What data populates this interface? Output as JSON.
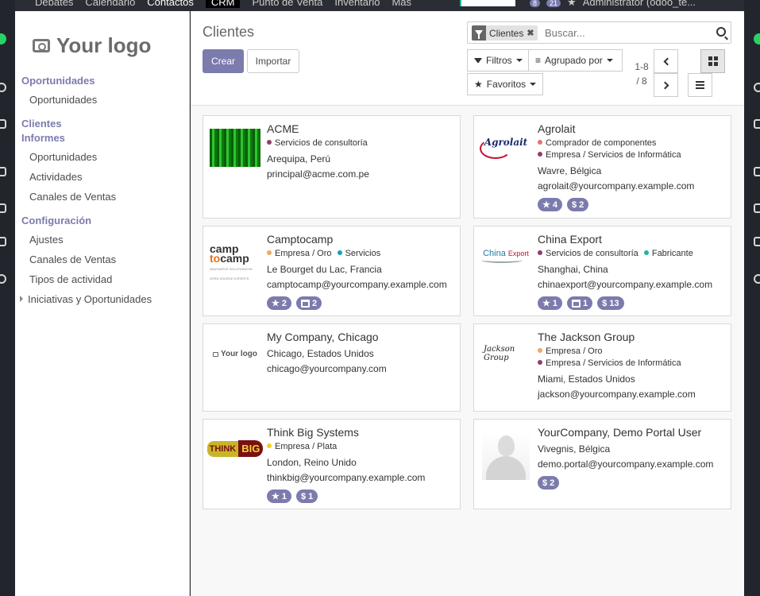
{
  "topnav": {
    "menu": [
      "Debates",
      "Calendario",
      "Contactos",
      "CRM",
      "Punto de Venta",
      "Inventario",
      "Más"
    ],
    "active": "Contactos",
    "messages_count": "8",
    "activities_count": "21",
    "user": "Administrator (odoo_te..."
  },
  "sidebar": {
    "logo_text": "Your logo",
    "sections": [
      {
        "title": "Oportunidades",
        "items": [
          "Oportunidades"
        ]
      },
      {
        "title": "Clientes",
        "items": []
      },
      {
        "title": "Informes",
        "items": [
          "Oportunidades",
          "Actividades",
          "Canales de Ventas"
        ]
      },
      {
        "title": "Configuración",
        "items": [
          "Ajustes",
          "Canales de Ventas",
          "Tipos de actividad",
          "Iniciativas y Oportunidades"
        ]
      }
    ]
  },
  "control": {
    "title": "Clientes",
    "create_label": "Crear",
    "import_label": "Importar",
    "search_facet": "Clientes",
    "search_placeholder": "Buscar...",
    "filters_label": "Filtros",
    "groupby_label": "Agrupado por",
    "favorites_label": "Favoritos",
    "pager_range": "1-8",
    "pager_total": "/ 8"
  },
  "colors": {
    "accent": "#7c7bad",
    "tag_purple": "#8e3f6a",
    "tag_red": "#e57373",
    "tag_orange": "#f0a862",
    "tag_teal": "#21b799",
    "tag_yellow": "#f2d023"
  },
  "cards": [
    {
      "name": "ACME",
      "logo": "green-curtain-image",
      "tags": [
        {
          "label": "Servicios de consultoría",
          "color": "#8e3f6a"
        }
      ],
      "lines": [
        "Arequipa, Perú",
        "principal@acme.com.pe"
      ],
      "badges": []
    },
    {
      "name": "Agrolait",
      "logo": "agrolait-logo",
      "logo_text": "Agrolait",
      "tags": [
        {
          "label": "Comprador de componentes",
          "color": "#e57373"
        },
        {
          "label": "Empresa / Servicios de Informática",
          "color": "#8e3f6a"
        }
      ],
      "lines": [
        "Wavre, Bélgica",
        "agrolait@yourcompany.example.com"
      ],
      "badges": [
        {
          "icon": "star",
          "value": "4"
        },
        {
          "icon": "dollar",
          "value": "2"
        }
      ]
    },
    {
      "name": "Camptocamp",
      "logo": "camptocamp-logo",
      "logo_text": "camptocamp",
      "tags": [
        {
          "label": "Empresa / Oro",
          "color": "#f0a862"
        },
        {
          "label": "Servicios",
          "color": "#17a2b8"
        }
      ],
      "lines": [
        "Le Bourget du Lac, Francia",
        "camptocamp@yourcompany.example.com"
      ],
      "badges": [
        {
          "icon": "star",
          "value": "2"
        },
        {
          "icon": "calendar",
          "value": "2"
        }
      ]
    },
    {
      "name": "China Export",
      "logo": "china-export-logo",
      "logo_text": "China Export",
      "tags": [
        {
          "label": "Servicios de consultoría",
          "color": "#8e3f6a"
        },
        {
          "label": "Fabricante",
          "color": "#21b799"
        }
      ],
      "lines": [
        "Shanghai, China",
        "chinaexport@yourcompany.example.com"
      ],
      "badges": [
        {
          "icon": "star",
          "value": "1"
        },
        {
          "icon": "calendar",
          "value": "1"
        },
        {
          "icon": "dollar",
          "value": "13"
        }
      ]
    },
    {
      "name": "My Company, Chicago",
      "logo": "your-logo-small",
      "logo_text": "Your logo",
      "tags": [],
      "lines": [
        "Chicago, Estados Unidos",
        "chicago@yourcompany.com"
      ],
      "badges": []
    },
    {
      "name": "The Jackson Group",
      "logo": "jackson-logo",
      "logo_text": "Jackson Group",
      "tags": [
        {
          "label": "Empresa / Oro",
          "color": "#f0a862"
        },
        {
          "label": "Empresa / Servicios de Informática",
          "color": "#8e3f6a"
        }
      ],
      "lines": [
        "Miami, Estados Unidos",
        "jackson@yourcompany.example.com"
      ],
      "badges": []
    },
    {
      "name": "Think Big Systems",
      "logo": "thinkbig-logo",
      "logo_text": "THINK BIG",
      "tags": [
        {
          "label": "Empresa / Plata",
          "color": "#f2d023"
        }
      ],
      "lines": [
        "London, Reino Unido",
        "thinkbig@yourcompany.example.com"
      ],
      "badges": [
        {
          "icon": "star",
          "value": "1"
        },
        {
          "icon": "dollar",
          "value": "1"
        }
      ]
    },
    {
      "name": "YourCompany, Demo Portal User",
      "logo": "avatar-placeholder",
      "tags": [],
      "lines": [
        "Vivegnis, Bélgica",
        "demo.portal@yourcompany.example.com"
      ],
      "badges": [
        {
          "icon": "dollar",
          "value": "2"
        }
      ]
    }
  ]
}
